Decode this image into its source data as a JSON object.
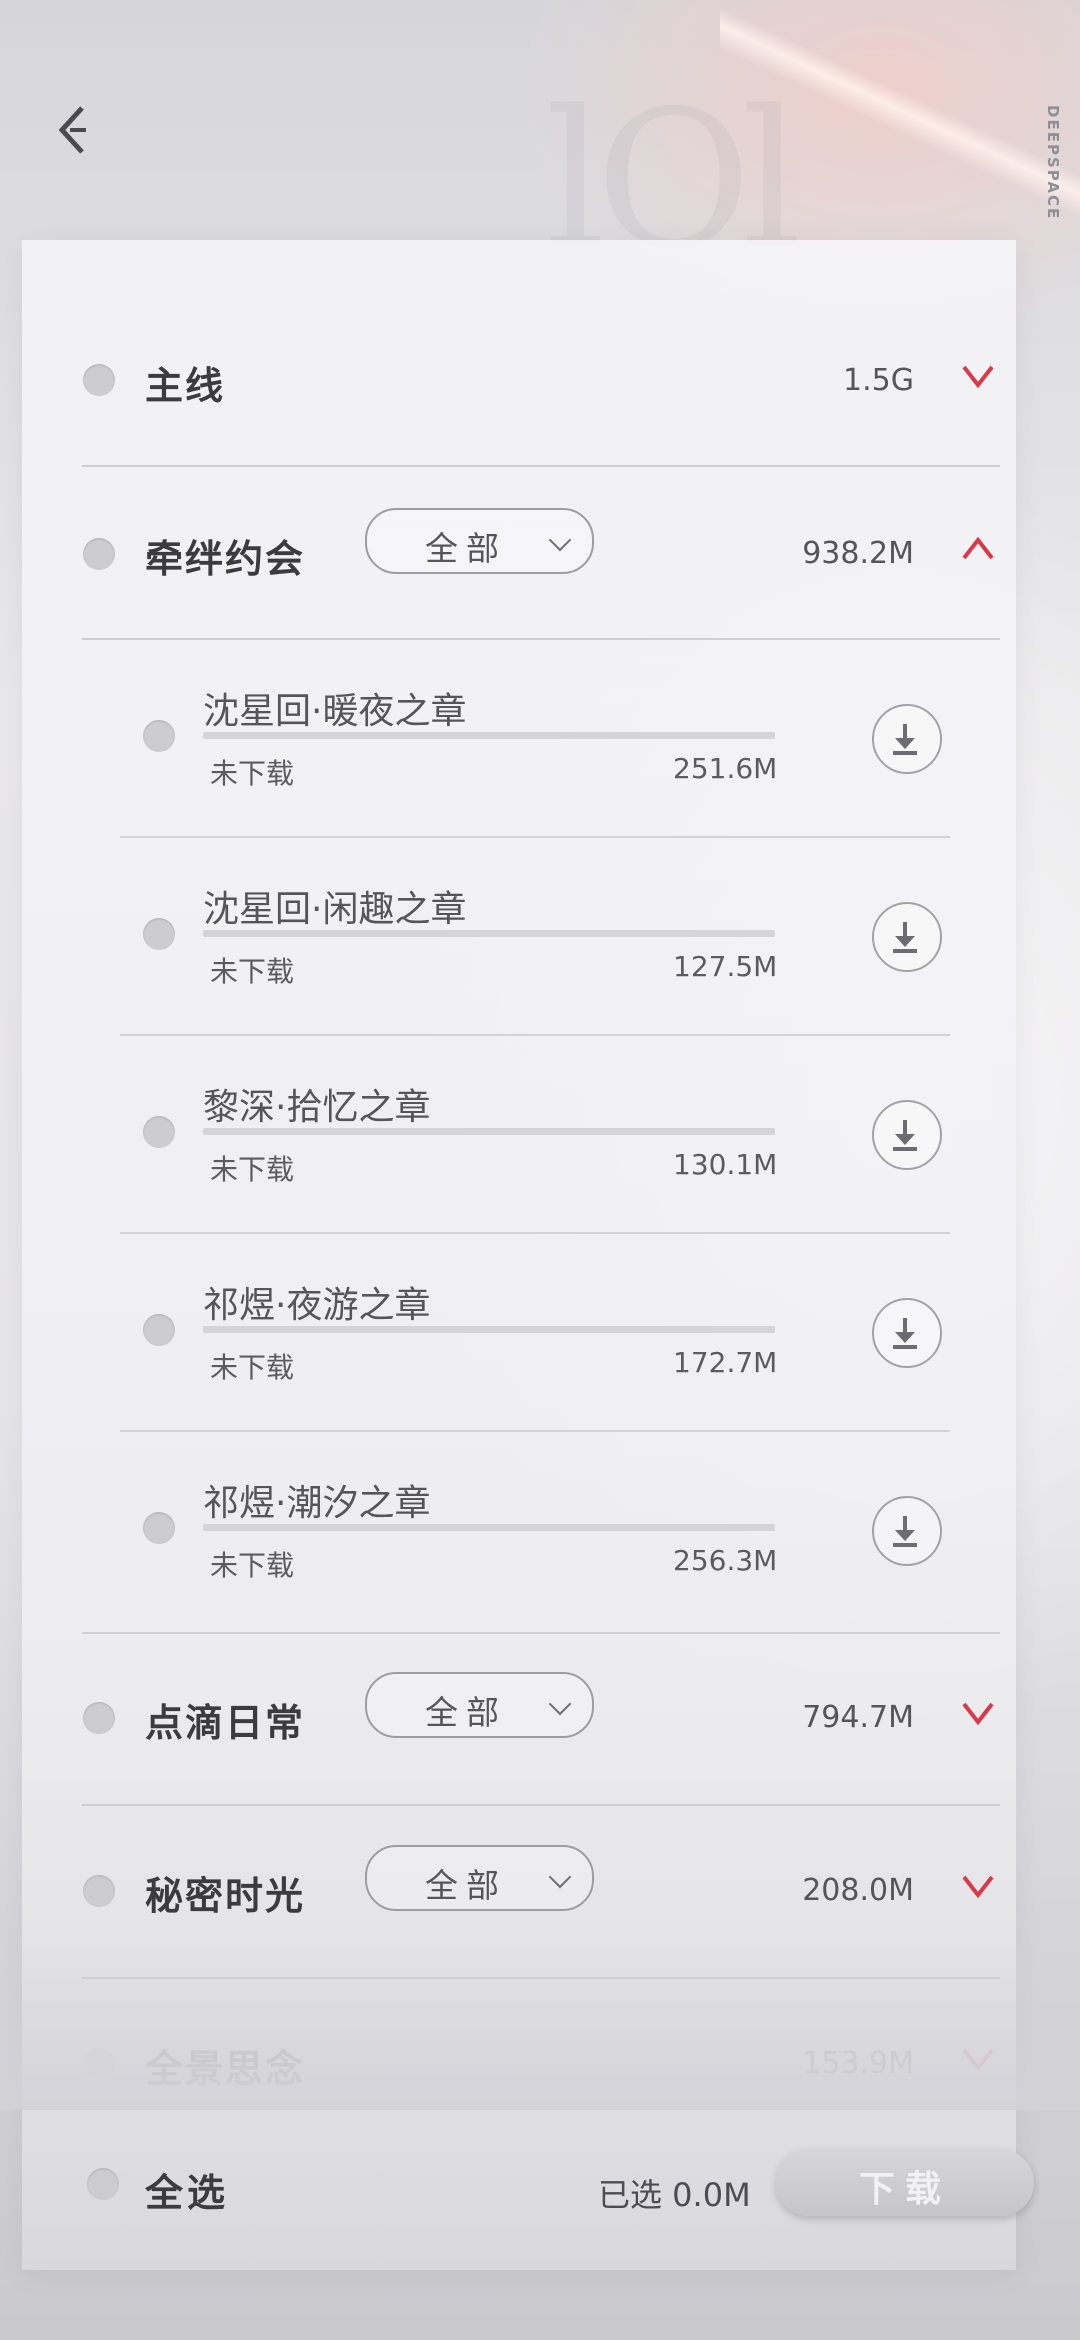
{
  "brand": "DEEPSPACE",
  "categories": [
    {
      "label": "主线",
      "size": "1.5G",
      "filter": "",
      "expanded": false
    },
    {
      "label": "牵绊约会",
      "size": "938.2M",
      "filter": "全部",
      "expanded": true
    },
    {
      "label": "点滴日常",
      "size": "794.7M",
      "filter": "全部",
      "expanded": false
    },
    {
      "label": "秘密时光",
      "size": "208.0M",
      "filter": "全部",
      "expanded": false
    },
    {
      "label": "全景思念",
      "size": "153.9M",
      "filter": "",
      "expanded": false
    }
  ],
  "chapters": [
    {
      "title": "沈星回·暖夜之章",
      "status": "未下载",
      "size": "251.6M"
    },
    {
      "title": "沈星回·闲趣之章",
      "status": "未下载",
      "size": "127.5M"
    },
    {
      "title": "黎深·拾忆之章",
      "status": "未下载",
      "size": "130.1M"
    },
    {
      "title": "祁煜·夜游之章",
      "status": "未下载",
      "size": "172.7M"
    },
    {
      "title": "祁煜·潮汐之章",
      "status": "未下载",
      "size": "256.3M"
    }
  ],
  "footer": {
    "select_all": "全选",
    "selected_text": "已选 0.0M",
    "download_label": "下载"
  },
  "colors": {
    "accent": "#d83a4a",
    "text": "#3c3c40",
    "radio": "#cdcdd1"
  }
}
